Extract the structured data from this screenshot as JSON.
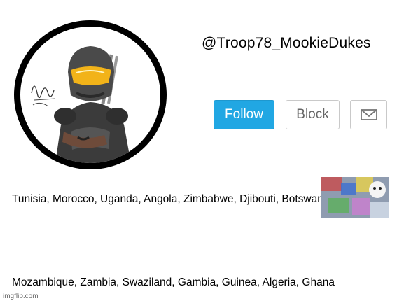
{
  "profile": {
    "handle": "@Troop78_MookieDukes",
    "avatar_icon": "armored-soldier-avatar"
  },
  "actions": {
    "follow_label": "Follow",
    "block_label": "Block",
    "message_icon": "envelope-icon"
  },
  "text_lines": [
    "Tunisia, Morocco, Uganda, Angola, Zimbabwe, Djibouti, Botswana!",
    "Mozambique, Zambia, Swaziland, Gambia, Guinea, Algeria, Ghana"
  ],
  "watermark": "imgflip.com",
  "colors": {
    "follow_bg": "#21a7e3",
    "ring": "#000000",
    "visor": "#f2b319"
  }
}
